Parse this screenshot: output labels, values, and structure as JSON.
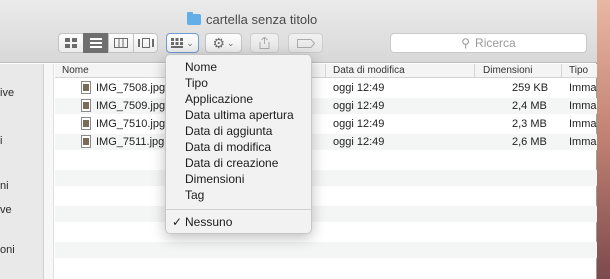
{
  "window": {
    "title": "cartella senza titolo"
  },
  "toolbar": {
    "view_buttons": [
      "icon-view",
      "list-view",
      "column-view",
      "cover-flow-view"
    ],
    "search_placeholder": "Ricerca"
  },
  "sidebar": {
    "items": [
      "ive",
      "i",
      "ni",
      "ve",
      "oni"
    ]
  },
  "list": {
    "columns": [
      "Nome",
      "Data di modifica",
      "Dimensioni",
      "Tipo"
    ],
    "rows": [
      {
        "name": "IMG_7508.jpg",
        "date": "oggi 12:49",
        "size": "259 KB",
        "type": "Imma"
      },
      {
        "name": "IMG_7509.jpg",
        "date": "oggi 12:49",
        "size": "2,4 MB",
        "type": "Imma"
      },
      {
        "name": "IMG_7510.jpg",
        "date": "oggi 12:49",
        "size": "2,3 MB",
        "type": "Imma"
      },
      {
        "name": "IMG_7511.jpg",
        "date": "oggi 12:49",
        "size": "2,6 MB",
        "type": "Imma"
      }
    ]
  },
  "menu": {
    "items": [
      "Nome",
      "Tipo",
      "Applicazione",
      "Data ultima apertura",
      "Data di aggiunta",
      "Data di modifica",
      "Data di creazione",
      "Dimensioni",
      "Tag"
    ],
    "checked_item": "Nessuno",
    "check_mark": "✓"
  }
}
